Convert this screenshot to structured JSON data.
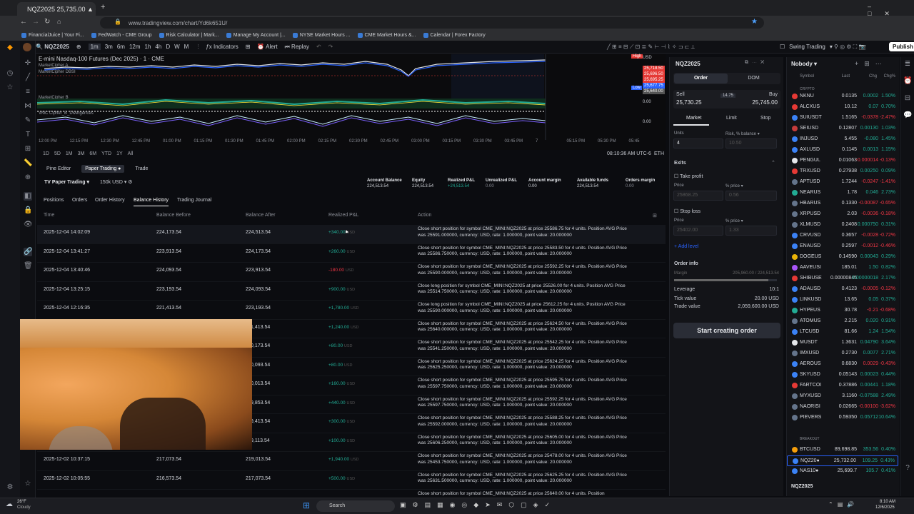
{
  "browser": {
    "tab_title": "NQZ2025 25,735.00 ▲ +0.4%",
    "new_tab": "+",
    "url": "www.tradingview.com/chart/Yd6k651U/",
    "bookmarks": [
      "FinancialJuice | Your Fi...",
      "FedWatch - CME Group",
      "Risk Calculator | Mark...",
      "Manage My Account |...",
      "NYSE Market Hours ...",
      "CME Market Hours &...",
      "Calendar | Forex Factory"
    ]
  },
  "toolbar": {
    "symbol": "NQZ2025",
    "intervals": [
      "1m",
      "3m",
      "6m",
      "12m",
      "1h",
      "4h",
      "D",
      "W",
      "M"
    ],
    "indicators": "Indicators",
    "alert": "Alert",
    "replay": "Replay",
    "layout_name": "Swing Trading",
    "publish": "Publish"
  },
  "chart": {
    "title": "E-mini Nasdaq-100 Futures (Dec 2025) · 1 · CME",
    "indicator_1": "MarketCipher A",
    "indicator_2": "MarketCipher DBSI",
    "indicator_3": "MarketCipher B",
    "indicator_4": "VMC Cipher_B_Divergences",
    "price_labels": [
      "25,718.50",
      "25,696.50",
      "25,695.25",
      "25,677.75",
      "25,640.00"
    ],
    "high_label": "High",
    "low_label": "Low",
    "usd_label": "USD",
    "zero_1": "0.00",
    "zero_2": "0.00",
    "time_ticks": [
      "12:00 PM",
      "12:15 PM",
      "12:30 PM",
      "12:45 PM",
      "01:00 PM",
      "01:15 PM",
      "01:30 PM",
      "01:45 PM",
      "02:00 PM",
      "02:15 PM",
      "02:30 PM",
      "02:45 PM",
      "03:00 PM",
      "03:15 PM",
      "03:30 PM",
      "03:45 PM",
      "7",
      "05:15 PM",
      "05:30 PM",
      "05:45"
    ],
    "ranges": [
      "1D",
      "5D",
      "1M",
      "3M",
      "6M",
      "YTD",
      "1Y",
      "All"
    ],
    "clock": "08:10:36 AM UTC-6",
    "eth": "ETH"
  },
  "panel": {
    "tabs": [
      "Pine Editor",
      "Paper Trading ●",
      "Trade"
    ],
    "account": "Paper Trading",
    "size": "150k USD",
    "summary": [
      {
        "label": "Account Balance",
        "value": "224,513.54"
      },
      {
        "label": "Equity",
        "value": "224,513.54"
      },
      {
        "label": "Realized P&L",
        "value": "+24,513.54"
      },
      {
        "label": "Unrealized P&L",
        "value": "0.00"
      },
      {
        "label": "Account margin",
        "value": "0.00"
      },
      {
        "label": "Available funds",
        "value": "224,513.54"
      },
      {
        "label": "Orders margin",
        "value": "0.00"
      }
    ],
    "subtabs": [
      "Positions",
      "Orders",
      "Order History",
      "Balance History",
      "Trading Journal"
    ],
    "columns": [
      "Time",
      "Balance Before",
      "Balance After",
      "Realized P&L",
      "Action"
    ],
    "rows": [
      {
        "time": "2025-12-04 14:02:09",
        "before": "224,173.54",
        "after": "224,513.54",
        "pnl": "+340.00",
        "cur": "USD",
        "sign": "pos",
        "action": "Close short position for symbol CME_MINI:NQZ2025 at price 25586.75 for 4 units. Position AVG Price was 25591.000000, currency: USD, rate: 1.000000, point value: 20.000000"
      },
      {
        "time": "2025-12-04 13:41:27",
        "before": "223,913.54",
        "after": "224,173.54",
        "pnl": "+260.00",
        "cur": "USD",
        "sign": "pos",
        "action": "Close short position for symbol CME_MINI:NQZ2025 at price 25583.50 for 4 units. Position AVG Price was 25586.750000, currency: USD, rate: 1.000000, point value: 20.000000"
      },
      {
        "time": "2025-12-04 13:40:46",
        "before": "224,093.54",
        "after": "223,913.54",
        "pnl": "-180.00",
        "cur": "USD",
        "sign": "neg",
        "action": "Close short position for symbol CME_MINI:NQZ2025 at price 25592.25 for 4 units. Position AVG Price was 25590.000000, currency: USD, rate: 1.000000, point value: 20.000000"
      },
      {
        "time": "2025-12-04 13:25:15",
        "before": "223,193.54",
        "after": "224,093.54",
        "pnl": "+900.00",
        "cur": "USD",
        "sign": "pos",
        "action": "Close long position for symbol CME_MINI:NQZ2025 at price 25526.00 for 4 units. Position AVG Price was 25514.750000, currency: USD, rate: 1.000000, point value: 20.000000"
      },
      {
        "time": "2025-12-04 12:16:35",
        "before": "221,413.54",
        "after": "223,193.54",
        "pnl": "+1,780.00",
        "cur": "USD",
        "sign": "pos",
        "action": "Close long position for symbol CME_MINI:NQZ2025 at price 25612.25 for 4 units. Position AVG Price was 25590.000000, currency: USD, rate: 1.000000, point value: 20.000000"
      },
      {
        "time": "",
        "before": "",
        "after": "…1,413.54",
        "pnl": "+1,240.00",
        "cur": "USD",
        "sign": "pos",
        "action": "Close short position for symbol CME_MINI:NQZ2025 at price 25624.50 for 4 units. Position AVG Price was 25640.000000, currency: USD, rate: 1.000000, point value: 20.000000"
      },
      {
        "time": "",
        "before": "",
        "after": "…0,173.54",
        "pnl": "+80.00",
        "cur": "USD",
        "sign": "pos",
        "action": "Close short position for symbol CME_MINI:NQZ2025 at price 25542.25 for 4 units. Position AVG Price was 25541.250000, currency: USD, rate: 1.000000, point value: 20.000000"
      },
      {
        "time": "",
        "before": "",
        "after": "…0,093.54",
        "pnl": "+80.00",
        "cur": "USD",
        "sign": "pos",
        "action": "Close short position for symbol CME_MINI:NQZ2025 at price 25624.25 for 4 units. Position AVG Price was 25625.250000, currency: USD, rate: 1.000000, point value: 20.000000"
      },
      {
        "time": "",
        "before": "",
        "after": "…0,013.54",
        "pnl": "+160.00",
        "cur": "USD",
        "sign": "pos",
        "action": "Close short position for symbol CME_MINI:NQZ2025 at price 25595.75 for 4 units. Position AVG Price was 25597.750000, currency: USD, rate: 1.000000, point value: 20.000000"
      },
      {
        "time": "",
        "before": "",
        "after": "…9,853.54",
        "pnl": "+440.00",
        "cur": "USD",
        "sign": "pos",
        "action": "Close short position for symbol CME_MINI:NQZ2025 at price 25592.25 for 4 units. Position AVG Price was 25597.750000, currency: USD, rate: 1.000000, point value: 20.000000"
      },
      {
        "time": "",
        "before": "",
        "after": "…9,413.54",
        "pnl": "+300.00",
        "cur": "USD",
        "sign": "pos",
        "action": "Close short position for symbol CME_MINI:NQZ2025 at price 25588.25 for 4 units. Position AVG Price was 25592.000000, currency: USD, rate: 1.000000, point value: 20.000000"
      },
      {
        "time": "",
        "before": "",
        "after": "…9,113.54",
        "pnl": "+100.00",
        "cur": "USD",
        "sign": "pos",
        "action": "Close short position for symbol CME_MINI:NQZ2025 at price 25605.00 for 4 units. Position AVG Price was 25606.250000, currency: USD, rate: 1.000000, point value: 20.000000"
      },
      {
        "time": "2025-12-02 10:37:15",
        "before": "217,073.54",
        "after": "219,013.54",
        "pnl": "+1,940.00",
        "cur": "USD",
        "sign": "pos",
        "action": "Close short position for symbol CME_MINI:NQZ2025 at price 25478.00 for 4 units. Position AVG Price was 25453.750000, currency: USD, rate: 1.000000, point value: 20.000000"
      },
      {
        "time": "2025-12-02 10:05:55",
        "before": "216,573.54",
        "after": "217,073.54",
        "pnl": "+500.00",
        "cur": "USD",
        "sign": "pos",
        "action": "Close short position for symbol CME_MINI:NQZ2025 at price 25625.25 for 4 units. Position AVG Price was 25631.500000, currency: USD, rate: 1.000000, point value: 20.000000"
      },
      {
        "time": "",
        "before": "",
        "after": "",
        "pnl": "",
        "cur": "",
        "sign": "pos",
        "action": "Close short position for symbol CME_MINI:NQZ2025 at price 25640.00 for 4 units. Position"
      }
    ]
  },
  "order": {
    "symbol": "NQZ2025",
    "tab_order": "Order",
    "tab_dom": "DOM",
    "sell_label": "Sell",
    "sell_price": "25,730.25",
    "spread": "14.75",
    "buy_label": "Buy",
    "buy_price": "25,745.00",
    "types": [
      "Market",
      "Limit",
      "Stop"
    ],
    "units_label": "Units",
    "units_value": "4",
    "risk_label": "Risk, % balance",
    "risk_value": "10.50",
    "exits": "Exits",
    "take_profit": "Take profit",
    "price_label": "Price",
    "pct_price": "% price",
    "tp_price": "25868.25",
    "tp_pct": "0.56",
    "stop_loss": "Stop loss",
    "sl_price": "25402.00",
    "sl_pct": "1.33",
    "add_level": "+ Add level",
    "order_info": "Order info",
    "margin_label": "Margin",
    "margin_value": "205,960.00 / 224,513.54",
    "leverage_label": "Leverage",
    "leverage_value": "10:1",
    "tick_label": "Tick value",
    "tick_value": "20.00 USD",
    "trade_label": "Trade value",
    "trade_value": "2,059,600.00 USD",
    "submit": "Start creating order"
  },
  "watchlist": {
    "title": "Nobody",
    "cols": [
      "Symbol",
      "Last",
      "Chg",
      "Chg%"
    ],
    "section_crypto": "CRYPTO",
    "section_breakout": "BREAKOUT",
    "footer_symbol": "NQZ2025",
    "items": [
      {
        "sym": "NKNU",
        "last": "0.0135",
        "chg": "0.0002",
        "pct": "1.50%",
        "c": "#22ab94",
        "dot": "#e53935"
      },
      {
        "sym": "ALCXUS",
        "last": "10.12",
        "chg": "0.07",
        "pct": "0.70%",
        "c": "#22ab94",
        "dot": "#e53935"
      },
      {
        "sym": "SUIUSDT",
        "last": "1.5165",
        "chg": "-0.0378",
        "pct": "-2.47%",
        "c": "#f23645",
        "dot": "#3b82f6"
      },
      {
        "sym": "SEIUSD",
        "last": "0.12807",
        "chg": "0.00130",
        "pct": "1.03%",
        "c": "#22ab94",
        "dot": "#c43b3b"
      },
      {
        "sym": "INJUSD",
        "last": "5.455",
        "chg": "-0.080",
        "pct": "1.45%",
        "c": "#22ab94",
        "dot": "#3b82f6"
      },
      {
        "sym": "AXLUSD",
        "last": "0.1145",
        "chg": "0.0013",
        "pct": "1.15%",
        "c": "#22ab94",
        "dot": "#3b82f6"
      },
      {
        "sym": "PENGUL",
        "last": "0.01063",
        "chg": "-0.000014",
        "pct": "-0.13%",
        "c": "#f23645",
        "dot": "#e5e7eb"
      },
      {
        "sym": "TRXUSD",
        "last": "0.27938",
        "chg": "0.00250",
        "pct": "0.09%",
        "c": "#22ab94",
        "dot": "#e53935"
      },
      {
        "sym": "APTUSD",
        "last": "1.7244",
        "chg": "-0.0247",
        "pct": "-1.41%",
        "c": "#f23645",
        "dot": "#64748b"
      },
      {
        "sym": "NEARUS",
        "last": "1.78",
        "chg": "0.046",
        "pct": "2.73%",
        "c": "#22ab94",
        "dot": "#22ab94"
      },
      {
        "sym": "HBARUS",
        "last": "0.1330",
        "chg": "-0.00087",
        "pct": "-0.65%",
        "c": "#f23645",
        "dot": "#64748b"
      },
      {
        "sym": "XRPUSD",
        "last": "2.03",
        "chg": "-0.0036",
        "pct": "-0.18%",
        "c": "#f23645",
        "dot": "#64748b"
      },
      {
        "sym": "XLMUSD",
        "last": "0.2408",
        "chg": "0.000750",
        "pct": "0.31%",
        "c": "#22ab94",
        "dot": "#64748b"
      },
      {
        "sym": "CRVUSD",
        "last": "0.3657",
        "chg": "-0.0028",
        "pct": "-0.72%",
        "c": "#f23645",
        "dot": "#3b82f6"
      },
      {
        "sym": "ENAUSD",
        "last": "0.2597",
        "chg": "-0.0012",
        "pct": "-0.46%",
        "c": "#f23645",
        "dot": "#3b82f6"
      },
      {
        "sym": "DOGEUS",
        "last": "0.14590",
        "chg": "0.00043",
        "pct": "0.29%",
        "c": "#22ab94",
        "dot": "#eab308"
      },
      {
        "sym": "AAVEUSI",
        "last": "185.01",
        "chg": "1.50",
        "pct": "0.82%",
        "c": "#22ab94",
        "dot": "#a855f7"
      },
      {
        "sym": "SHIBUSE",
        "last": "0.00000845",
        "chg": "0.00000018",
        "pct": "2.17%",
        "c": "#22ab94",
        "dot": "#e53935"
      },
      {
        "sym": "ADAUSD",
        "last": "0.4123",
        "chg": "-0.0005",
        "pct": "-0.12%",
        "c": "#f23645",
        "dot": "#3b82f6"
      },
      {
        "sym": "LINKUSD",
        "last": "13.65",
        "chg": "0.05",
        "pct": "0.37%",
        "c": "#22ab94",
        "dot": "#3b82f6"
      },
      {
        "sym": "HYPEUS",
        "last": "30.78",
        "chg": "-0.21",
        "pct": "-0.68%",
        "c": "#f23645",
        "dot": "#22ab94"
      },
      {
        "sym": "ATOMUS",
        "last": "2.215",
        "chg": "0.020",
        "pct": "0.91%",
        "c": "#22ab94",
        "dot": "#64748b"
      },
      {
        "sym": "LTCUSD",
        "last": "81.66",
        "chg": "1.24",
        "pct": "1.54%",
        "c": "#22ab94",
        "dot": "#3b82f6"
      },
      {
        "sym": "MUSDT",
        "last": "1.3631",
        "chg": "0.04790",
        "pct": "3.64%",
        "c": "#22ab94",
        "dot": "#e5e7eb"
      },
      {
        "sym": "IMXUSD",
        "last": "0.2730",
        "chg": "0.0077",
        "pct": "2.71%",
        "c": "#22ab94",
        "dot": "#64748b"
      },
      {
        "sym": "AEROUS",
        "last": "0.6830",
        "chg": "0.0029",
        "pct": "-0.43%",
        "c": "#f23645",
        "dot": "#3b82f6"
      },
      {
        "sym": "SKYUSD",
        "last": "0.05143",
        "chg": "0.00023",
        "pct": "0.44%",
        "c": "#22ab94",
        "dot": "#3b82f6"
      },
      {
        "sym": "FARTCOI",
        "last": "0.37886",
        "chg": "0.00441",
        "pct": "1.18%",
        "c": "#22ab94",
        "dot": "#e53935"
      },
      {
        "sym": "MYXUSD",
        "last": "3.1160",
        "chg": "-0.07588",
        "pct": "2.49%",
        "c": "#22ab94",
        "dot": "#64748b"
      },
      {
        "sym": "NAORISI",
        "last": "0.02665",
        "chg": "-0.00100",
        "pct": "-3.62%",
        "c": "#f23645",
        "dot": "#64748b"
      },
      {
        "sym": "PIEVERS",
        "last": "0.59350",
        "chg": "0.05712",
        "pct": "10.64%",
        "c": "#22ab94",
        "dot": "#64748b"
      },
      {
        "sym": "BTCUSD",
        "last": "89,698.85",
        "chg": "353.56",
        "pct": "0.40%",
        "c": "#22ab94",
        "dot": "#f59e0b"
      },
      {
        "sym": "NQZ20●",
        "last": "25,732.00",
        "chg": "109.25",
        "pct": "0.43%",
        "c": "#22ab94",
        "dot": "#3b82f6"
      },
      {
        "sym": "NAS10●",
        "last": "25,699.7",
        "chg": "105.7",
        "pct": "0.41%",
        "c": "#22ab94",
        "dot": "#3b82f6"
      }
    ]
  },
  "taskbar": {
    "weather_temp": "26°F",
    "weather_desc": "Cloudy",
    "search": "Search",
    "time": "8:10 AM",
    "date": "12/6/2025"
  }
}
